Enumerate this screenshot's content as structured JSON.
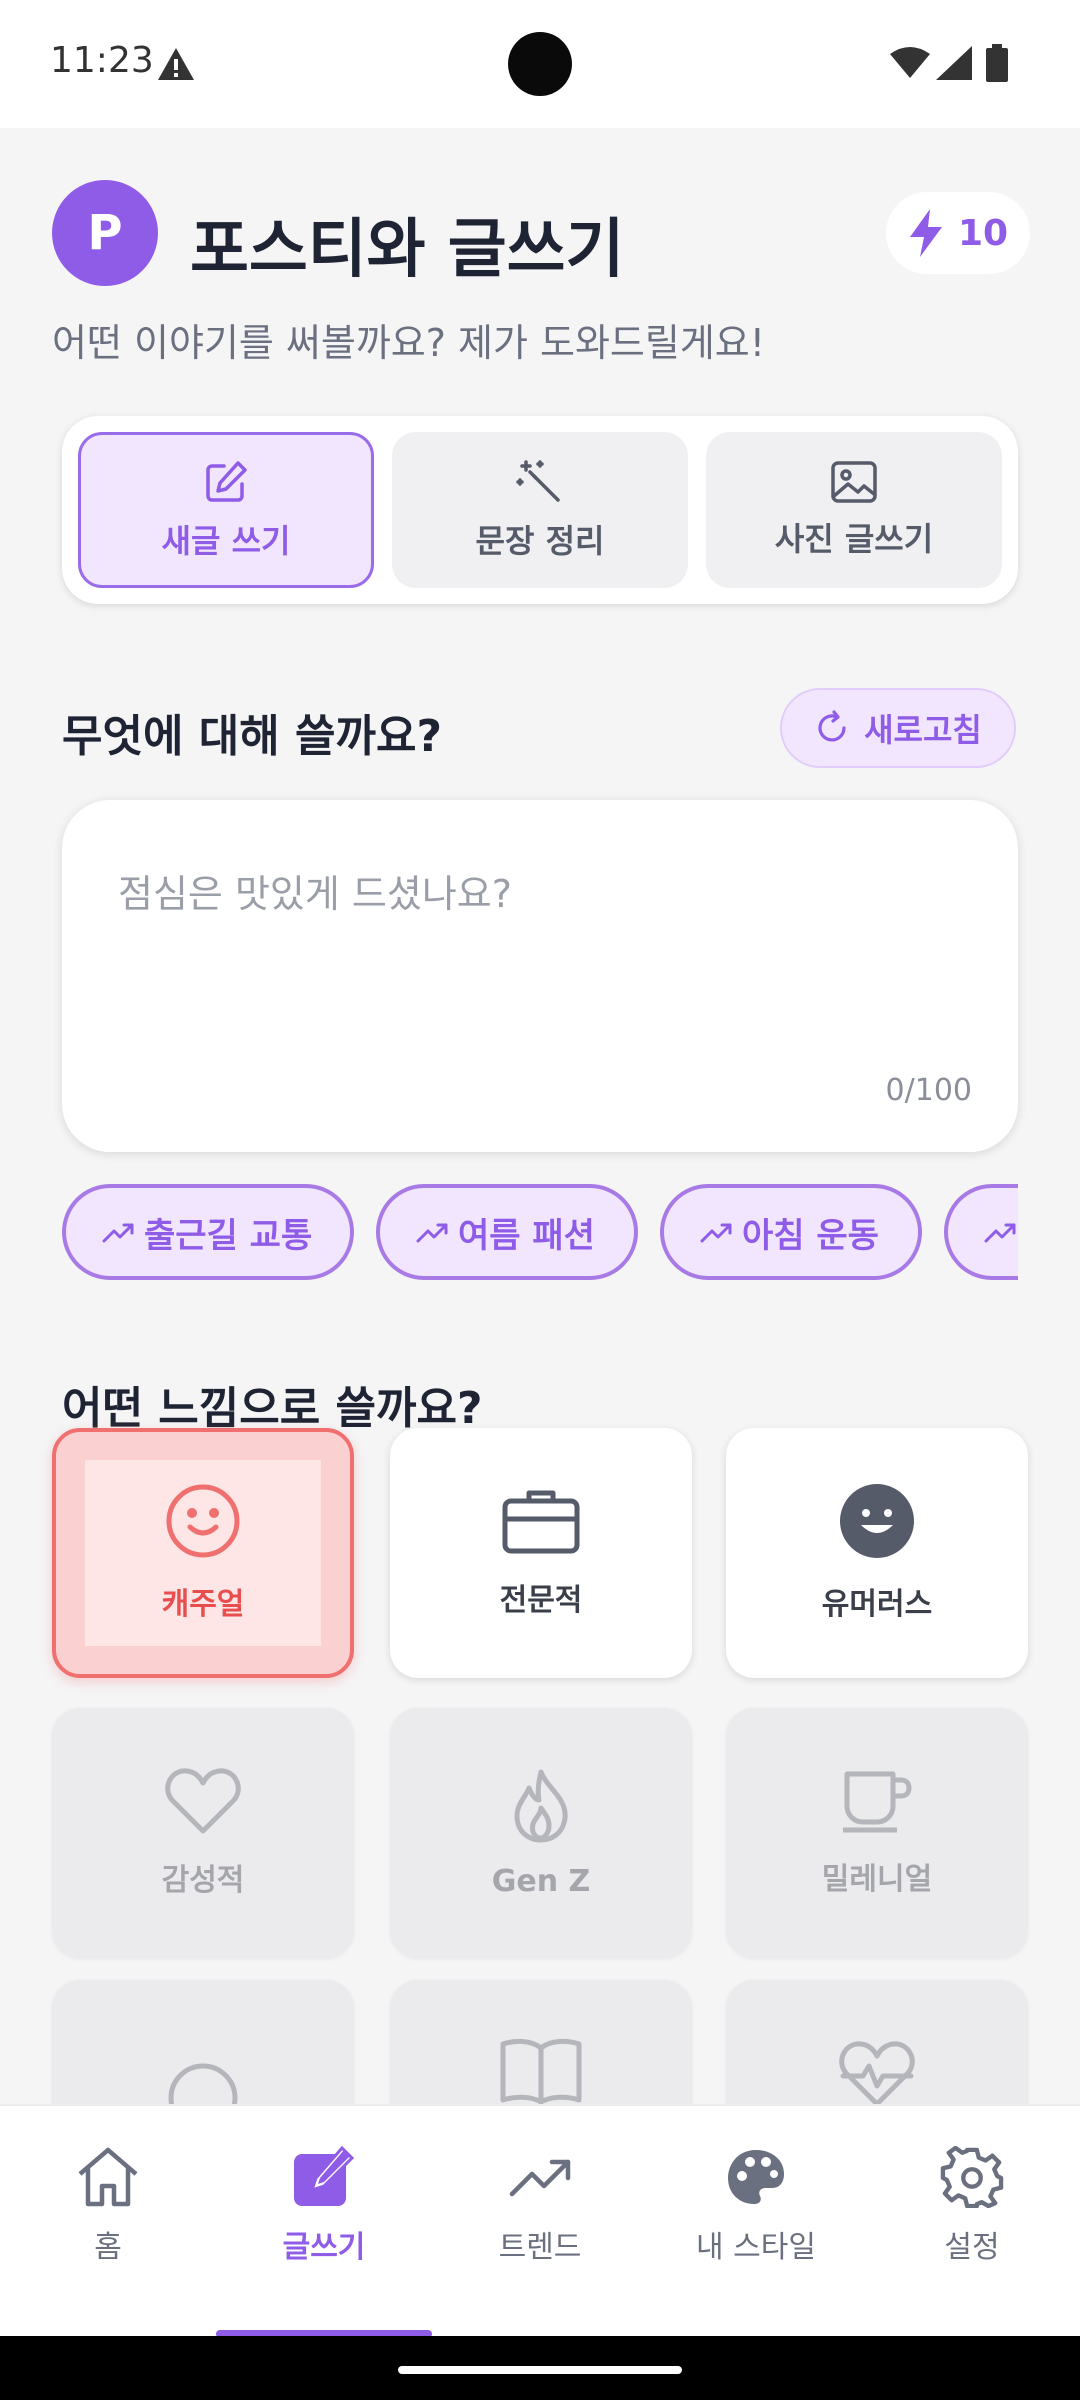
{
  "status_bar": {
    "time": "11:23"
  },
  "header": {
    "avatar_letter": "P",
    "title": "포스티와 글쓰기",
    "credits": "10",
    "subtitle": "어떤 이야기를 써볼까요? 제가 도와드릴게요!"
  },
  "modes": [
    {
      "label": "새글 쓰기",
      "icon": "edit-square-icon",
      "active": true
    },
    {
      "label": "문장 정리",
      "icon": "magic-wand-icon",
      "active": false
    },
    {
      "label": "사진 글쓰기",
      "icon": "image-icon",
      "active": false
    }
  ],
  "topic_section": {
    "title": "무엇에 대해 쓸까요?",
    "refresh_label": "새로고침",
    "placeholder": "점심은 맛있게 드셨나요?",
    "char_count": "0/100"
  },
  "trending_chips": [
    {
      "label": "출근길 교통"
    },
    {
      "label": "여름 패션"
    },
    {
      "label": "아침 운동"
    },
    {
      "label": ""
    }
  ],
  "tone_section": {
    "title": "어떤 느낌으로 쓸까요?",
    "tones": [
      {
        "label": "캐주얼",
        "icon": "smile-icon",
        "state": "selected"
      },
      {
        "label": "전문적",
        "icon": "briefcase-icon",
        "state": "available"
      },
      {
        "label": "유머러스",
        "icon": "laugh-icon",
        "state": "available"
      },
      {
        "label": "감성적",
        "icon": "heart-icon",
        "state": "locked"
      },
      {
        "label": "Gen Z",
        "icon": "flame-icon",
        "state": "locked"
      },
      {
        "label": "밀레니얼",
        "icon": "coffee-cup-icon",
        "state": "locked"
      },
      {
        "label": "",
        "icon": "circle-icon",
        "state": "locked"
      },
      {
        "label": "",
        "icon": "book-icon",
        "state": "locked"
      },
      {
        "label": "",
        "icon": "heart-pulse-icon",
        "state": "locked"
      }
    ]
  },
  "bottom_nav": [
    {
      "label": "홈",
      "icon": "home-icon",
      "active": false
    },
    {
      "label": "글쓰기",
      "icon": "write-icon",
      "active": true
    },
    {
      "label": "트렌드",
      "icon": "trending-icon",
      "active": false
    },
    {
      "label": "내 스타일",
      "icon": "palette-icon",
      "active": false
    },
    {
      "label": "설정",
      "icon": "gear-icon",
      "active": false
    }
  ],
  "colors": {
    "primary": "#8f5ce8",
    "primary_light": "#f1e6fd",
    "selected_tone": "#f06f6f",
    "background": "#f5f5f6"
  }
}
